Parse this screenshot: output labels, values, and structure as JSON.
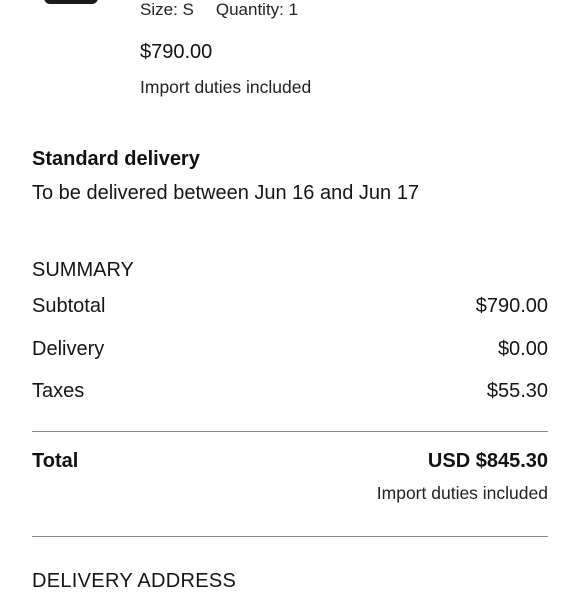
{
  "item": {
    "size": "Size: S",
    "quantity": "Quantity: 1",
    "price": "$790.00",
    "duties_note": "Import duties included"
  },
  "delivery": {
    "title": "Standard delivery",
    "window": "To be delivered between Jun 16 and Jun 17"
  },
  "summary": {
    "title": "SUMMARY",
    "subtotal_label": "Subtotal",
    "subtotal_value": "$790.00",
    "delivery_label": "Delivery",
    "delivery_value": "$0.00",
    "taxes_label": "Taxes",
    "taxes_value": "$55.30",
    "total_label": "Total",
    "total_value": "USD $845.30",
    "total_duties_note": "Import duties included"
  },
  "address": {
    "title": "DELIVERY ADDRESS"
  }
}
